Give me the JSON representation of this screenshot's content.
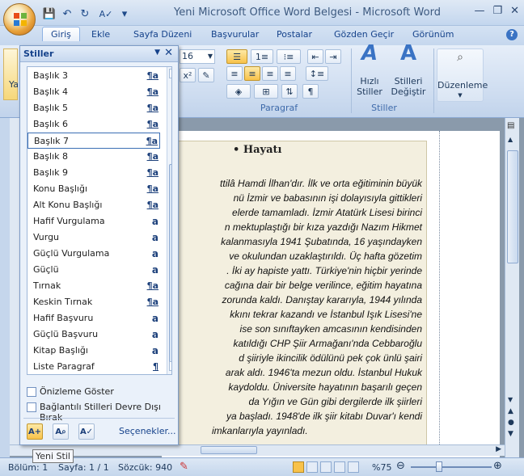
{
  "window": {
    "title": "Yeni Microsoft Office Word Belgesi - Microsoft Word",
    "minimize": "—",
    "restore": "❐",
    "close": "✕"
  },
  "qat": {
    "save": "💾",
    "undo": "↶",
    "redo": "↻",
    "spell": "A✓",
    "customize": "▾"
  },
  "tabs": [
    "Giriş",
    "Ekle",
    "Sayfa Düzeni",
    "Başvurular",
    "Postalar",
    "Gözden Geçir",
    "Görünüm"
  ],
  "help_icon": "?",
  "ribbon": {
    "paste_label_partial": "Ya",
    "font_size": "16",
    "paragraph_label": "Paragraf",
    "styles_group_label": "Stiller",
    "quick_styles_label": "Hızlı\nStiller",
    "change_styles_label": "Stilleri\nDeğiştir",
    "editing_label": "Düzenleme"
  },
  "styles_pane": {
    "title": "Stiller",
    "items": [
      {
        "name": "Başlık 3",
        "icon": "¶a"
      },
      {
        "name": "Başlık 4",
        "icon": "¶a"
      },
      {
        "name": "Başlık 5",
        "icon": "¶a"
      },
      {
        "name": "Başlık 6",
        "icon": "¶a"
      },
      {
        "name": "Başlık 7",
        "icon": "¶a",
        "selected": true
      },
      {
        "name": "Başlık 8",
        "icon": "¶a"
      },
      {
        "name": "Başlık 9",
        "icon": "¶a"
      },
      {
        "name": "Konu Başlığı",
        "icon": "¶a"
      },
      {
        "name": "Alt Konu Başlığı",
        "icon": "¶a"
      },
      {
        "name": "Hafif Vurgulama",
        "icon": "a"
      },
      {
        "name": "Vurgu",
        "icon": "a"
      },
      {
        "name": "Güçlü Vurgulama",
        "icon": "a"
      },
      {
        "name": "Güçlü",
        "icon": "a"
      },
      {
        "name": "Tırnak",
        "icon": "¶a"
      },
      {
        "name": "Keskin Tırnak",
        "icon": "¶a"
      },
      {
        "name": "Hafif Başvuru",
        "icon": "a"
      },
      {
        "name": "Güçlü Başvuru",
        "icon": "a"
      },
      {
        "name": "Kitap Başlığı",
        "icon": "a"
      },
      {
        "name": "Liste Paragraf",
        "icon": "¶"
      }
    ],
    "preview_label": "Önizleme Göster",
    "disable_linked_label": "Bağlantılı Stilleri Devre Dışı Bırak",
    "options_link": "Seçenekler...",
    "new_style_tooltip": "Yeni Stil"
  },
  "document": {
    "heading": "Hayatı",
    "lines": [
      "ttilâ Hamdi İlhan'dır. İlk ve orta eğitiminin büyük",
      "nü İzmir ve babasının işi dolayısıyla gittikleri",
      "elerde tamamladı. İzmir Atatürk Lisesi birinci",
      "n mektuplaştığı bir kıza yazdığı Nazım Hikmet",
      "kalanmasıyla 1941 Şubatında, 16 yaşındayken",
      "ve okulundan uzaklaştırıldı. Üç hafta gözetim",
      ". İki ay hapiste yattı. Türkiye'nin hiçbir yerinde",
      "cağına dair bir belge verilince, eğitim hayatına",
      "zorunda kaldı. Danıştay kararıyla, 1944 yılında",
      "kkını tekrar kazandı ve İstanbul Işık Lisesi'ne",
      "ise son sınıftayken amcasının kendisinden",
      "katıldığı CHP Şiir Armağanı'nda Cebbaroğlu",
      "d şiiriyle ikincilik ödülünü pek çok ünlü şairi",
      "arak aldı. 1946'ta mezun oldu. İstanbul Hukuk",
      "kaydoldu. Üniversite hayatının başarılı geçen",
      "da Yığın ve Gün gibi dergilerde ilk şiirleri",
      "ya başladı. 1948'de ilk şiir kitabı Duvar'ı kendi",
      "imkanlarıyla yayınladı."
    ]
  },
  "status": {
    "section": "Bölüm: 1",
    "page": "Sayfa: 1 / 1",
    "words": "Sözcük: 940",
    "zoom": "%75"
  }
}
